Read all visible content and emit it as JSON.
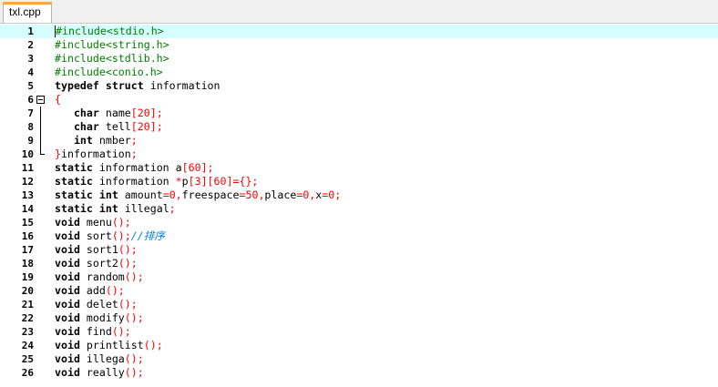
{
  "tab": {
    "filename": "txl.cpp"
  },
  "lines": [
    {
      "n": "1",
      "tokens": [
        {
          "t": "#include<stdio.h>",
          "c": "pp"
        }
      ]
    },
    {
      "n": "2",
      "tokens": [
        {
          "t": "#include<string.h>",
          "c": "pp"
        }
      ]
    },
    {
      "n": "3",
      "tokens": [
        {
          "t": "#include<stdlib.h>",
          "c": "pp"
        }
      ]
    },
    {
      "n": "4",
      "tokens": [
        {
          "t": "#include<conio.h>",
          "c": "pp"
        }
      ]
    },
    {
      "n": "5",
      "tokens": [
        {
          "t": "typedef",
          "c": "kw"
        },
        {
          "t": " "
        },
        {
          "t": "struct",
          "c": "kw"
        },
        {
          "t": " information"
        }
      ]
    },
    {
      "n": "6",
      "tokens": [
        {
          "t": "{",
          "c": "op"
        }
      ]
    },
    {
      "n": "7",
      "tokens": [
        {
          "t": "   "
        },
        {
          "t": "char",
          "c": "kw"
        },
        {
          "t": " name"
        },
        {
          "t": "[",
          "c": "op"
        },
        {
          "t": "20",
          "c": "numlit"
        },
        {
          "t": "];",
          "c": "op"
        }
      ]
    },
    {
      "n": "8",
      "tokens": [
        {
          "t": "   "
        },
        {
          "t": "char",
          "c": "kw"
        },
        {
          "t": " tell"
        },
        {
          "t": "[",
          "c": "op"
        },
        {
          "t": "20",
          "c": "numlit"
        },
        {
          "t": "];",
          "c": "op"
        }
      ]
    },
    {
      "n": "9",
      "tokens": [
        {
          "t": "   "
        },
        {
          "t": "int",
          "c": "kw"
        },
        {
          "t": " nmber"
        },
        {
          "t": ";",
          "c": "op"
        }
      ]
    },
    {
      "n": "10",
      "tokens": [
        {
          "t": "}",
          "c": "op"
        },
        {
          "t": "information"
        },
        {
          "t": ";",
          "c": "op"
        }
      ]
    },
    {
      "n": "11",
      "tokens": [
        {
          "t": "static",
          "c": "kw"
        },
        {
          "t": " information a"
        },
        {
          "t": "[",
          "c": "op"
        },
        {
          "t": "60",
          "c": "numlit"
        },
        {
          "t": "];",
          "c": "op"
        }
      ]
    },
    {
      "n": "12",
      "tokens": [
        {
          "t": "static",
          "c": "kw"
        },
        {
          "t": " information "
        },
        {
          "t": "*",
          "c": "op"
        },
        {
          "t": "p"
        },
        {
          "t": "[",
          "c": "op"
        },
        {
          "t": "3",
          "c": "numlit"
        },
        {
          "t": "][",
          "c": "op"
        },
        {
          "t": "60",
          "c": "numlit"
        },
        {
          "t": "]={};",
          "c": "op"
        }
      ]
    },
    {
      "n": "13",
      "tokens": [
        {
          "t": "static",
          "c": "kw"
        },
        {
          "t": " "
        },
        {
          "t": "int",
          "c": "kw"
        },
        {
          "t": " amount"
        },
        {
          "t": "=",
          "c": "op"
        },
        {
          "t": "0",
          "c": "numlit"
        },
        {
          "t": ",",
          "c": "op"
        },
        {
          "t": "freespace"
        },
        {
          "t": "=",
          "c": "op"
        },
        {
          "t": "50",
          "c": "numlit"
        },
        {
          "t": ",",
          "c": "op"
        },
        {
          "t": "place"
        },
        {
          "t": "=",
          "c": "op"
        },
        {
          "t": "0",
          "c": "numlit"
        },
        {
          "t": ",",
          "c": "op"
        },
        {
          "t": "x"
        },
        {
          "t": "=",
          "c": "op"
        },
        {
          "t": "0",
          "c": "numlit"
        },
        {
          "t": ";",
          "c": "op"
        }
      ]
    },
    {
      "n": "14",
      "tokens": [
        {
          "t": "static",
          "c": "kw"
        },
        {
          "t": " "
        },
        {
          "t": "int",
          "c": "kw"
        },
        {
          "t": " illegal"
        },
        {
          "t": ";",
          "c": "op"
        }
      ]
    },
    {
      "n": "15",
      "tokens": [
        {
          "t": "void",
          "c": "kw"
        },
        {
          "t": " menu"
        },
        {
          "t": "();",
          "c": "op"
        }
      ]
    },
    {
      "n": "16",
      "tokens": [
        {
          "t": "void",
          "c": "kw"
        },
        {
          "t": " sort"
        },
        {
          "t": "();",
          "c": "op"
        },
        {
          "t": "//排序",
          "c": "cm"
        }
      ]
    },
    {
      "n": "17",
      "tokens": [
        {
          "t": "void",
          "c": "kw"
        },
        {
          "t": " sort1"
        },
        {
          "t": "();",
          "c": "op"
        }
      ]
    },
    {
      "n": "18",
      "tokens": [
        {
          "t": "void",
          "c": "kw"
        },
        {
          "t": " sort2"
        },
        {
          "t": "();",
          "c": "op"
        }
      ]
    },
    {
      "n": "19",
      "tokens": [
        {
          "t": "void",
          "c": "kw"
        },
        {
          "t": " random"
        },
        {
          "t": "();",
          "c": "op"
        }
      ]
    },
    {
      "n": "20",
      "tokens": [
        {
          "t": "void",
          "c": "kw"
        },
        {
          "t": " add"
        },
        {
          "t": "();",
          "c": "op"
        }
      ]
    },
    {
      "n": "21",
      "tokens": [
        {
          "t": "void",
          "c": "kw"
        },
        {
          "t": " delet"
        },
        {
          "t": "();",
          "c": "op"
        }
      ]
    },
    {
      "n": "22",
      "tokens": [
        {
          "t": "void",
          "c": "kw"
        },
        {
          "t": " modify"
        },
        {
          "t": "();",
          "c": "op"
        }
      ]
    },
    {
      "n": "23",
      "tokens": [
        {
          "t": "void",
          "c": "kw"
        },
        {
          "t": " find"
        },
        {
          "t": "();",
          "c": "op"
        }
      ]
    },
    {
      "n": "24",
      "tokens": [
        {
          "t": "void",
          "c": "kw"
        },
        {
          "t": " printlist"
        },
        {
          "t": "();",
          "c": "op"
        }
      ]
    },
    {
      "n": "25",
      "tokens": [
        {
          "t": "void",
          "c": "kw"
        },
        {
          "t": " illega"
        },
        {
          "t": "();",
          "c": "op"
        }
      ]
    },
    {
      "n": "26",
      "tokens": [
        {
          "t": "void",
          "c": "kw"
        },
        {
          "t": " really"
        },
        {
          "t": "();",
          "c": "op"
        }
      ]
    }
  ]
}
